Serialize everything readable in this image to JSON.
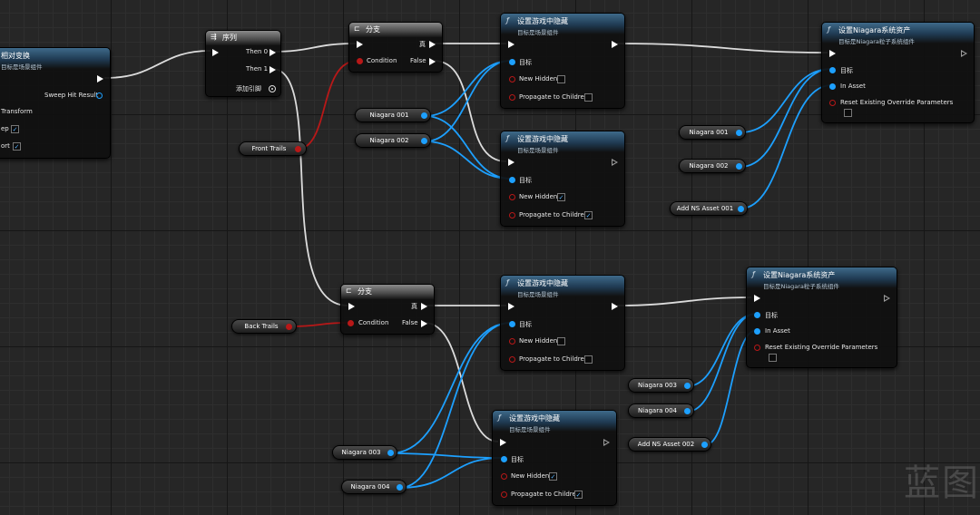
{
  "colors": {
    "exec_wire": "#dcdcdc",
    "object_wire": "#1da0ff",
    "bool_wire": "#b81818",
    "function_header": "#2f5677"
  },
  "nodes": {
    "transform_node": {
      "title": "相对变换",
      "subtitle": "目标是场景组件",
      "sweep": "Sweep Hit Result",
      "transform": "Transform",
      "sweep_pin": "ep",
      "teleport_pin": "ort"
    },
    "sequence": {
      "title": "序列",
      "then0": "Then 0",
      "then1": "Then 1",
      "add_pin": "添加引脚"
    },
    "branch1": {
      "title": "分支",
      "true_label": "真",
      "condition": "Condition",
      "false_label": "False"
    },
    "branch2": {
      "title": "分支",
      "true_label": "真",
      "condition": "Condition",
      "false_label": "False"
    },
    "hidden1": {
      "title": "设置游戏中隐藏",
      "subtitle": "目标是场景组件",
      "target": "目标",
      "new_hidden": "New Hidden",
      "propagate": "Propagate to Children"
    },
    "hidden2": {
      "title": "设置游戏中隐藏",
      "subtitle": "目标是场景组件",
      "target": "目标",
      "new_hidden": "New Hidden",
      "propagate": "Propagate to Children"
    },
    "hidden3": {
      "title": "设置游戏中隐藏",
      "subtitle": "目标是场景组件",
      "target": "目标",
      "new_hidden": "New Hidden",
      "propagate": "Propagate to Children"
    },
    "hidden4": {
      "title": "设置游戏中隐藏",
      "subtitle": "目标是场景组件",
      "target": "目标",
      "new_hidden": "New Hidden",
      "propagate": "Propagate to Children"
    },
    "niagara1": {
      "title": "设置Niagara系统资产",
      "subtitle": "目标是Niagara粒子系统组件",
      "target": "目标",
      "in_asset": "In Asset",
      "reset": "Reset Existing Override Parameters"
    },
    "niagara2": {
      "title": "设置Niagara系统资产",
      "subtitle": "目标是Niagara粒子系统组件",
      "target": "目标",
      "in_asset": "In Asset",
      "reset": "Reset Existing Override Parameters"
    }
  },
  "variables": {
    "front_trails": "Front Trails",
    "back_trails": "Back Trails",
    "niagara001_a": "Niagara 001",
    "niagara002_a": "Niagara 002",
    "niagara001_b": "Niagara 001",
    "niagara002_b": "Niagara 002",
    "add_ns_asset001": "Add NS Asset 001",
    "niagara003_a": "Niagara 003",
    "niagara004_a": "Niagara 004",
    "niagara003_b": "Niagara 003",
    "niagara004_b": "Niagara 004",
    "add_ns_asset002": "Add NS Asset 002"
  },
  "checkbox_states": {
    "hidden1_new_hidden": false,
    "hidden1_propagate": false,
    "hidden2_new_hidden": true,
    "hidden2_propagate": true,
    "hidden3_new_hidden": false,
    "hidden3_propagate": false,
    "hidden4_new_hidden": true,
    "hidden4_propagate": true,
    "niagara1_reset": false,
    "niagara2_reset": false,
    "transform_sweep": true,
    "transform_teleport": true
  },
  "watermark": "蓝图"
}
